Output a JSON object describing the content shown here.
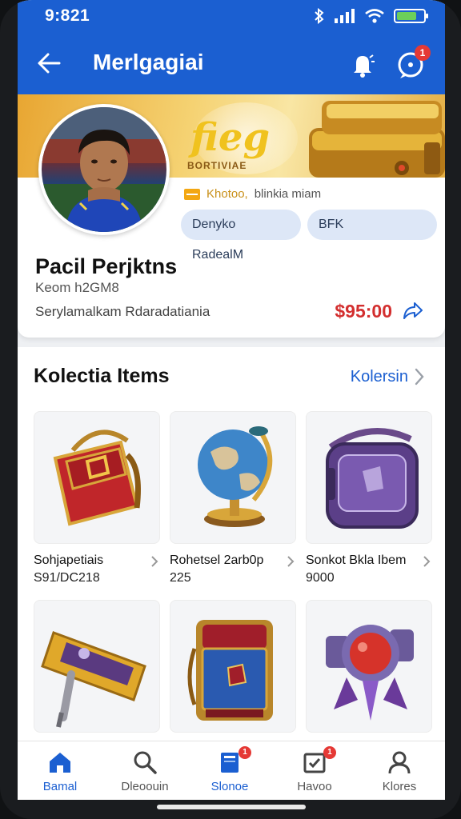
{
  "status": {
    "time": "9:821",
    "battery_level": 0.75
  },
  "header": {
    "title": "Merlgagiai",
    "notification_count": "1"
  },
  "profile": {
    "banner_text": "fieg",
    "banner_subtext": "BORTIVIAE",
    "rank_label_gold": "Khotoo,",
    "rank_label": "blinkia miam",
    "chip_1": "Denyko RadealM",
    "chip_2": "BFK",
    "name": "Pacil Perjktns",
    "id": "Keom h2GM8",
    "description": "Serylamalkam Rdaradatiania",
    "price": "$95:00"
  },
  "collection": {
    "title": "Kolectia Items",
    "link": "Kolersin",
    "items": [
      {
        "name": "Sohjapetiais",
        "price": "S91/DC218",
        "icon": "red-satchel"
      },
      {
        "name": "Rohetsel 2arb0p",
        "price": "225",
        "icon": "globe"
      },
      {
        "name": "Sonkot Bkla Ibem",
        "price": "9000",
        "icon": "purple-bag"
      },
      {
        "name": "",
        "price": "",
        "icon": "golden-hammer"
      },
      {
        "name": "",
        "price": "",
        "icon": "blue-backpack"
      },
      {
        "name": "",
        "price": "",
        "icon": "robot-orb"
      }
    ]
  },
  "nav": {
    "items": [
      {
        "label": "Bamal",
        "icon": "home-icon",
        "active": true,
        "badge": ""
      },
      {
        "label": "Dleoouin",
        "icon": "search-icon",
        "active": false,
        "badge": ""
      },
      {
        "label": "Slonoe",
        "icon": "book-icon",
        "active": true,
        "badge": "1"
      },
      {
        "label": "Havoo",
        "icon": "inbox-icon",
        "active": false,
        "badge": "1"
      },
      {
        "label": "Klores",
        "icon": "profile-icon",
        "active": false,
        "badge": ""
      }
    ]
  },
  "colors": {
    "primary": "#1b5fd1",
    "price": "#d32f2f",
    "gold": "#f0c21e"
  }
}
